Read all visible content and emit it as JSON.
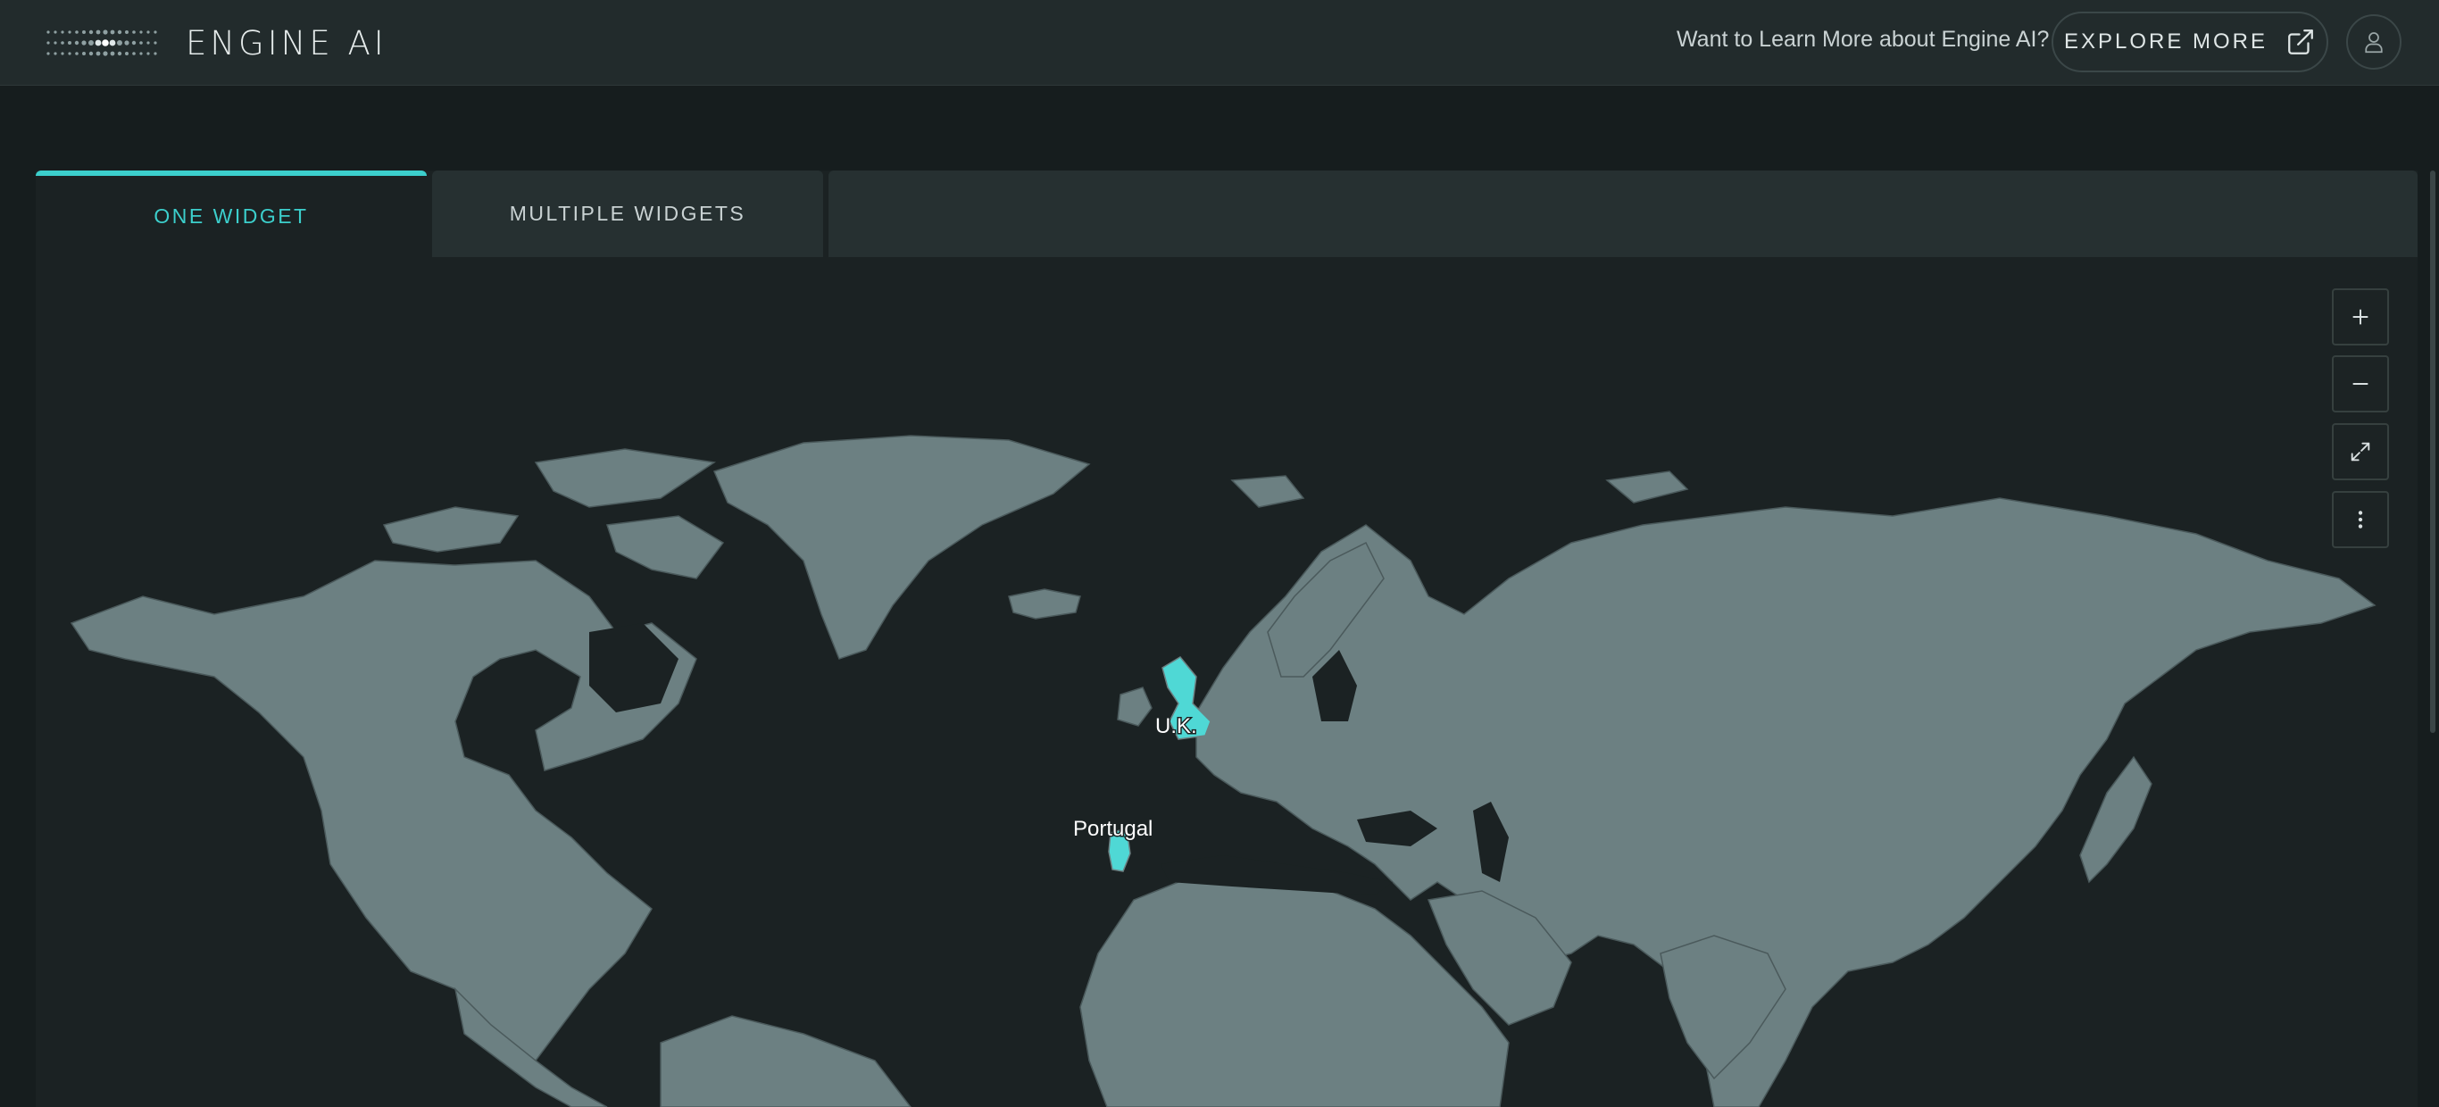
{
  "header": {
    "brand": "ENGINE AI",
    "learn_text": "Want to Learn More about Engine AI?",
    "explore_label": "EXPLORE MORE"
  },
  "tabs": [
    {
      "label": "ONE WIDGET",
      "active": true
    },
    {
      "label": "MULTIPLE WIDGETS",
      "active": false
    }
  ],
  "map": {
    "highlighted_countries": [
      {
        "label": "U.K.",
        "color": "#4fd8d5"
      },
      {
        "label": "Portugal",
        "color": "#4fd8d5"
      }
    ],
    "land_color": "#6c8082",
    "water_color": "#1b2223"
  },
  "map_controls": [
    {
      "name": "zoom-in",
      "icon": "plus-icon"
    },
    {
      "name": "zoom-out",
      "icon": "minus-icon"
    },
    {
      "name": "fullscreen",
      "icon": "expand-icon"
    },
    {
      "name": "more",
      "icon": "more-vertical-icon"
    }
  ],
  "colors": {
    "accent": "#3ccfcc",
    "background": "#161d1e",
    "header": "#222b2c"
  }
}
